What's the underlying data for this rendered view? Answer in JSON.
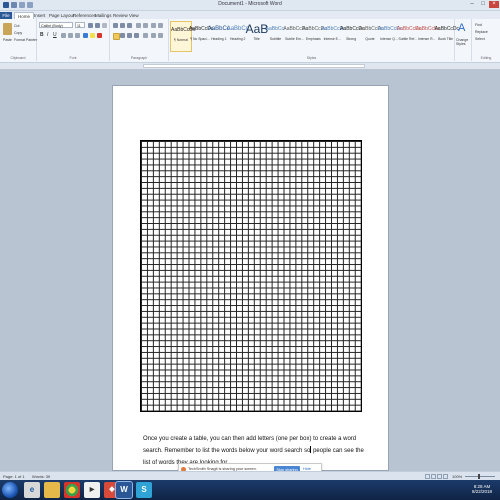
{
  "window": {
    "title": "Document1 - Microsoft Word"
  },
  "tabs": [
    "File",
    "Home",
    "Insert",
    "Page Layout",
    "References",
    "Mailings",
    "Review",
    "View"
  ],
  "clipboard": {
    "paste": "Paste",
    "cut": "Cut",
    "copy": "Copy",
    "format_painter": "Format Painter",
    "group": "Clipboard"
  },
  "font": {
    "name": "Calibri (Body)",
    "size": "11",
    "group": "Font"
  },
  "paragraph": {
    "group": "Paragraph"
  },
  "styles": {
    "items": [
      {
        "sample": "AaBbCcDc",
        "name": "¶ Normal"
      },
      {
        "sample": "AaBbCcDc",
        "name": "¶ No Spaci..."
      },
      {
        "sample": "AaBbCc",
        "name": "Heading 1"
      },
      {
        "sample": "AaBbCc",
        "name": "Heading 2"
      },
      {
        "sample": "AaB",
        "name": "Title"
      },
      {
        "sample": "AaBbCc.",
        "name": "Subtitle"
      },
      {
        "sample": "AaBbCcDc",
        "name": "Subtle Em..."
      },
      {
        "sample": "AaBbCcDc",
        "name": "Emphasis"
      },
      {
        "sample": "AaBbCcDc",
        "name": "Intense E..."
      },
      {
        "sample": "AaBbCcDc",
        "name": "Strong"
      },
      {
        "sample": "AaBbCcDc",
        "name": "Quote"
      },
      {
        "sample": "AaBbCcDc",
        "name": "Intense Q..."
      },
      {
        "sample": "AaBbCcDc",
        "name": "Subtle Ref..."
      },
      {
        "sample": "AaBbCcDc",
        "name": "Intense R..."
      },
      {
        "sample": "AaBbCcDc",
        "name": "Book Title"
      }
    ],
    "change_styles": "Change Styles",
    "group": "Styles"
  },
  "editing": {
    "find": "Find",
    "replace": "Replace",
    "select": "Select",
    "group": "Editing"
  },
  "document": {
    "paragraph_before": "Once you create a table, you can then add letters (one per box) to create a word search. Remember to list the words below your word search so",
    "paragraph_after": "people can see the list of words they are looking for.",
    "grid_rows": 46,
    "grid_cols": 37
  },
  "notification": {
    "message": "TechSmith Snagit is sharing your screen.",
    "stop": "Stop sharing",
    "hide": "Hide"
  },
  "status": {
    "page": "Page: 1 of 1",
    "words": "Words: 39",
    "zoom": "100%"
  },
  "taskbar": {
    "time": "8:28 AM",
    "date": "8/22/2018"
  },
  "colors": {
    "file_tab": "#2b5797",
    "close": "#c9463d",
    "taskbar": "#1c3b6a"
  }
}
